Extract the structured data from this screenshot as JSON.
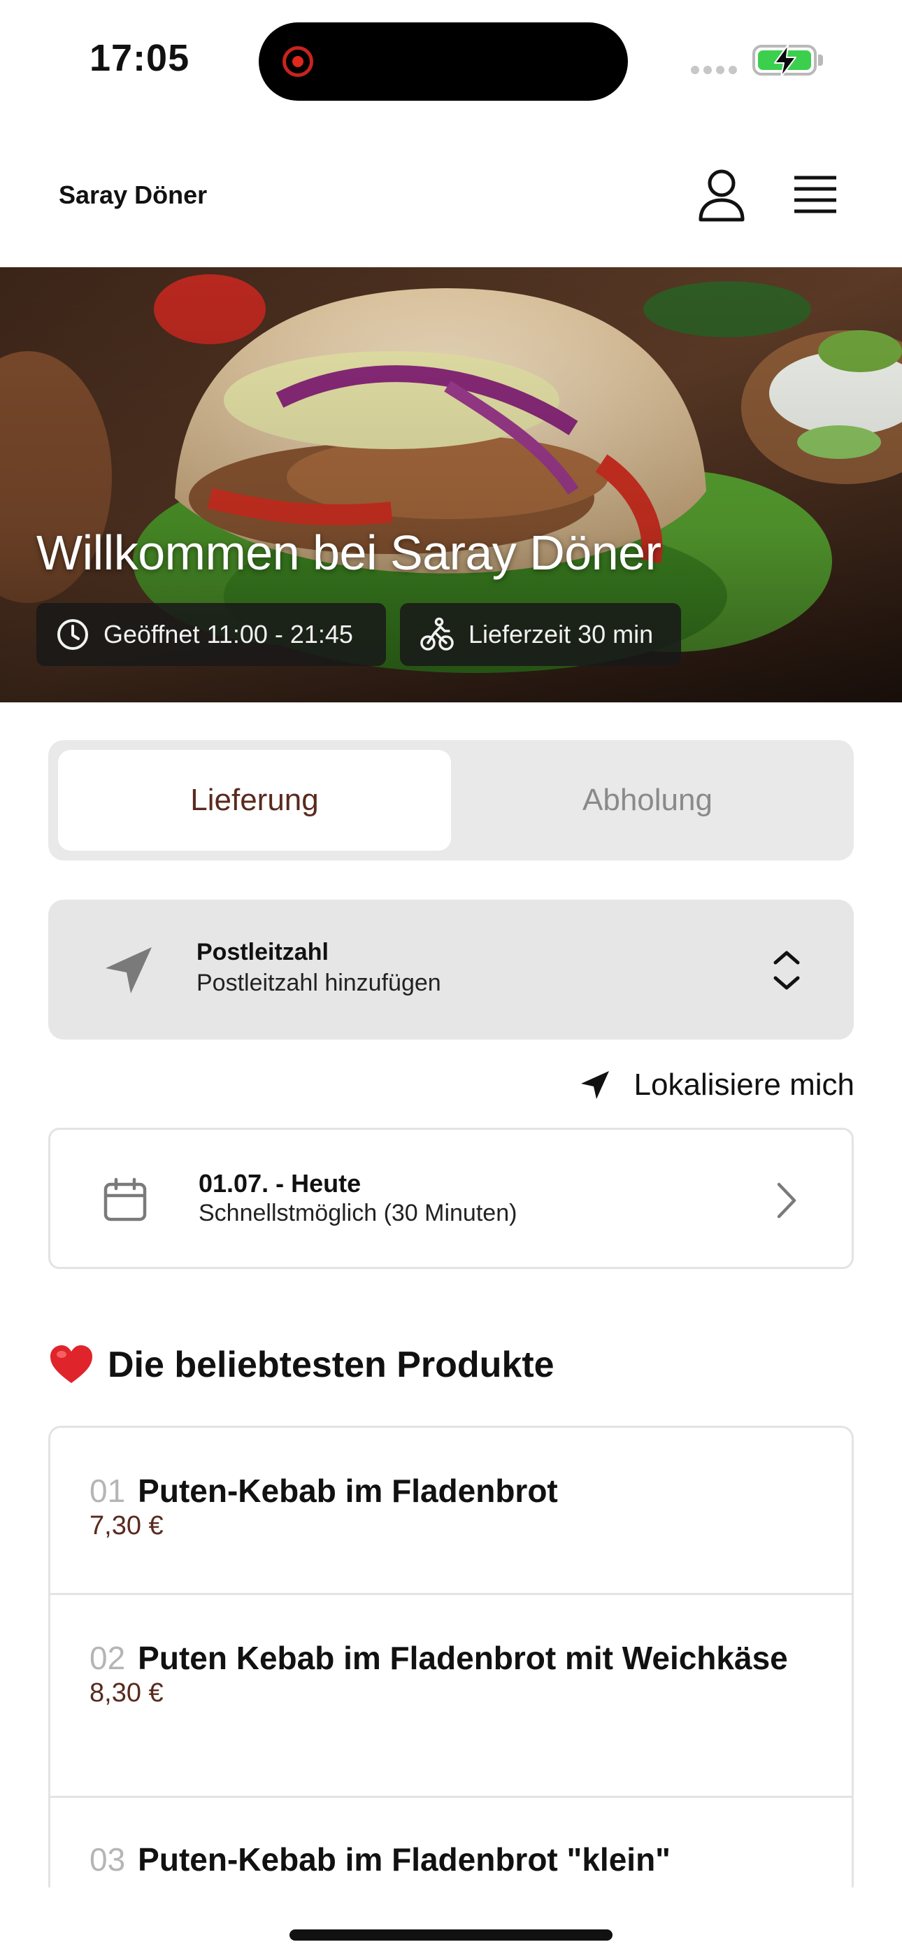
{
  "status_bar": {
    "time": "17:05"
  },
  "header": {
    "brand": "Saray Döner",
    "account_icon": "person-icon",
    "menu_icon": "hamburger-menu-icon"
  },
  "hero": {
    "title": "Willkommen bei Saray Döner",
    "opening_hours": "Geöffnet 11:00 - 21:45",
    "delivery_time": "Lieferzeit 30 min",
    "image": "doner-kebab-photo"
  },
  "order_mode": {
    "options": [
      "Lieferung",
      "Abholung"
    ],
    "selected": "Lieferung"
  },
  "postcode": {
    "label": "Postleitzahl",
    "placeholder": "Postleitzahl hinzufügen"
  },
  "locate": {
    "label": "Lokalisiere mich"
  },
  "date": {
    "primary": "01.07. - Heute",
    "secondary": "Schnellstmöglich (30 Minuten)"
  },
  "popular": {
    "title": "Die beliebtesten Produkte",
    "items": [
      {
        "number": "01",
        "name": "Puten-Kebab im Fladenbrot",
        "price": "7,30 €"
      },
      {
        "number": "02",
        "name": "Puten Kebab im Fladenbrot mit Weichkäse",
        "price": "8,30 €"
      },
      {
        "number": "03",
        "name": "Puten-Kebab im Fladenbrot \"klein\"",
        "price": ""
      }
    ]
  },
  "colors": {
    "accent": "#5a2a1e",
    "segment_bg": "#e9e9e9",
    "field_bg": "#e6e6e6",
    "border": "#e3e3e3",
    "battery": "#3ccf4e",
    "recording": "#e2271d"
  }
}
